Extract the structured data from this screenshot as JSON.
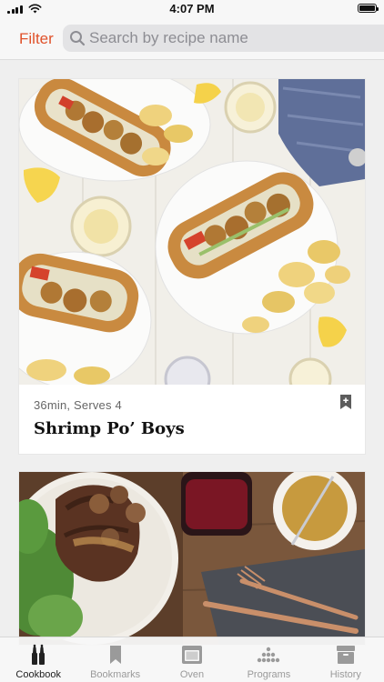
{
  "status_bar": {
    "time": "4:07 PM"
  },
  "header": {
    "filter_label": "Filter",
    "search_placeholder": "Search by recipe name"
  },
  "recipes": [
    {
      "meta": "36min, Serves 4",
      "title": "Shrimp Po’ Boys",
      "image_icon": "shrimp-po-boys-photo"
    },
    {
      "meta": "",
      "title": "",
      "image_icon": "steak-mushrooms-photo"
    }
  ],
  "tab_bar": {
    "tabs": [
      {
        "label": "Cookbook",
        "icon": "cookbook-icon",
        "active": true
      },
      {
        "label": "Bookmarks",
        "icon": "bookmark-icon",
        "active": false
      },
      {
        "label": "Oven",
        "icon": "oven-icon",
        "active": false
      },
      {
        "label": "Programs",
        "icon": "programs-icon",
        "active": false
      },
      {
        "label": "History",
        "icon": "history-icon",
        "active": false
      }
    ]
  },
  "colors": {
    "accent": "#e0522b",
    "tab_active": "#222222",
    "tab_inactive": "#9a9a9a"
  }
}
